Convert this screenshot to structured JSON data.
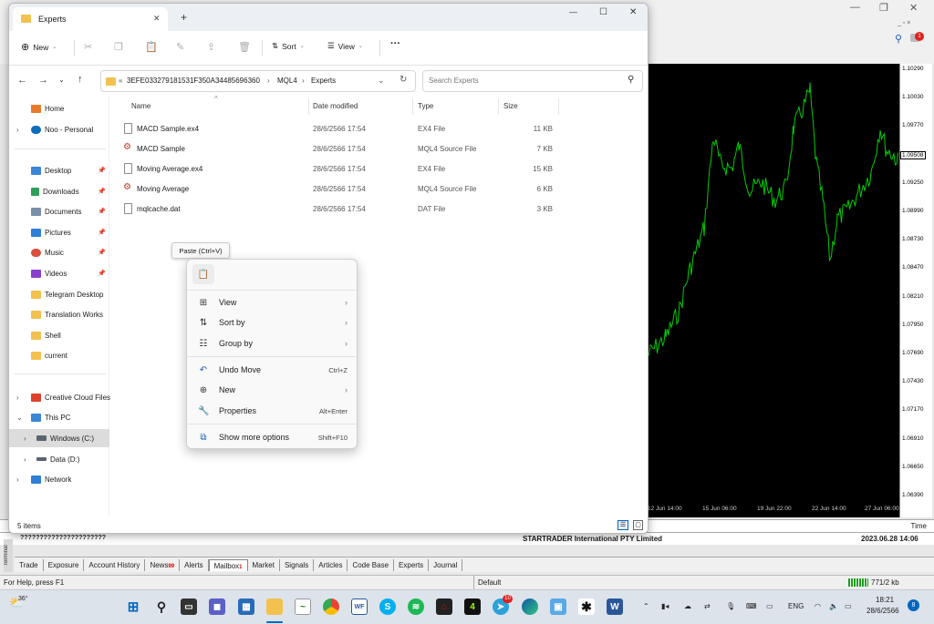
{
  "explorer": {
    "tab_title": "Experts",
    "new_tab": "+",
    "window_controls": {
      "minimize": "—",
      "maximize": "☐",
      "close": "✕"
    },
    "toolbar": {
      "new_label": "New",
      "sort_label": "Sort",
      "view_label": "View",
      "more_label": "···"
    },
    "address": {
      "ellipsis": "«",
      "segments": [
        "3EFE033279181531F350A34485696360",
        "MQL4",
        "Experts"
      ],
      "separator": "›"
    },
    "search_placeholder": "Search Experts",
    "nav": {
      "home": "Home",
      "onedrive": "Noo - Personal",
      "desktop": "Desktop",
      "downloads": "Downloads",
      "documents": "Documents",
      "pictures": "Pictures",
      "music": "Music",
      "videos": "Videos",
      "telegram": "Telegram Desktop",
      "translation": "Translation Works",
      "shell": "Shell",
      "current": "current",
      "creative": "Creative Cloud Files",
      "thispc": "This PC",
      "windows_c": "Windows (C:)",
      "data_d": "Data (D:)",
      "network": "Network"
    },
    "columns": {
      "name": "Name",
      "date": "Date modified",
      "type": "Type",
      "size": "Size"
    },
    "files": [
      {
        "name": "MACD Sample.ex4",
        "date": "28/6/2566 17:54",
        "type": "EX4 File",
        "size": "11 KB"
      },
      {
        "name": "MACD Sample",
        "date": "28/6/2566 17:54",
        "type": "MQL4 Source File",
        "size": "7 KB"
      },
      {
        "name": "Moving Average.ex4",
        "date": "28/6/2566 17:54",
        "type": "EX4 File",
        "size": "15 KB"
      },
      {
        "name": "Moving Average",
        "date": "28/6/2566 17:54",
        "type": "MQL4 Source File",
        "size": "6 KB"
      },
      {
        "name": "mqlcache.dat",
        "date": "28/6/2566 17:54",
        "type": "DAT File",
        "size": "3 KB"
      }
    ],
    "status": "5 items"
  },
  "context_menu": {
    "tooltip": "Paste (Ctrl+V)",
    "items": {
      "view": {
        "label": "View"
      },
      "sort_by": {
        "label": "Sort by"
      },
      "group_by": {
        "label": "Group by"
      },
      "undo_move": {
        "label": "Undo Move",
        "shortcut": "Ctrl+Z"
      },
      "new": {
        "label": "New"
      },
      "properties": {
        "label": "Properties",
        "shortcut": "Alt+Enter"
      },
      "show_more": {
        "label": "Show more options",
        "shortcut": "Shift+F10"
      }
    }
  },
  "mt4": {
    "prices": [
      "1.10290",
      "1.10030",
      "1.09770",
      "1.09508",
      "1.09250",
      "1.08990",
      "1.08730",
      "1.08470",
      "1.08210",
      "1.07950",
      "1.07690",
      "1.07430",
      "1.07170",
      "1.06910",
      "1.06650",
      "1.06390"
    ],
    "current_price": "1.09508",
    "dates": [
      "12 Jun 14:00",
      "15 Jun 06:00",
      "19 Jun 22:00",
      "22 Jun 14:00",
      "27 Jun 06:00"
    ],
    "time_label": "Time",
    "broker_row_name": "??????????????????????",
    "broker": "STARTRADER International PTY Limited",
    "broker_time": "2023.06.28 14:06",
    "terminal_label": "Terminal",
    "tabs": [
      "Trade",
      "Exposure",
      "Account History",
      "News",
      "Alerts",
      "Mailbox",
      "Market",
      "Signals",
      "Articles",
      "Code Base",
      "Experts",
      "Journal"
    ],
    "news_count": "99",
    "mailbox_count": "1",
    "status_help": "For Help, press F1",
    "status_default": "Default",
    "status_traffic": "771/2 kb",
    "notif_count": "1"
  },
  "taskbar": {
    "weather": "36°",
    "lang": "ENG",
    "time": "18:21",
    "date": "28/6/2566",
    "notif": "8",
    "telegram_badge": "10"
  },
  "colors": {
    "chart_line": "#00cc00",
    "folder": "#f2c14e",
    "accent": "#0067c0"
  }
}
